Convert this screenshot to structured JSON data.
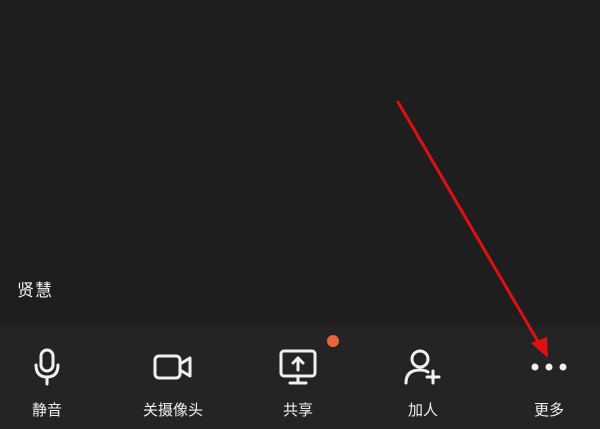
{
  "participant": {
    "name": "贤慧"
  },
  "toolbar": {
    "mute_label": "静音",
    "camera_label": "关摄像头",
    "share_label": "共享",
    "add_label": "加人",
    "more_label": "更多"
  },
  "icons": {
    "mute": "microphone-icon",
    "camera": "video-camera-icon",
    "share": "screen-share-icon",
    "add": "add-person-icon",
    "more": "more-dots-icon"
  },
  "colors": {
    "background": "#1f1f1f",
    "toolbar": "#242424",
    "text": "#f0f0f0",
    "badge": "#e9663c",
    "annotation_arrow": "#e01010"
  }
}
